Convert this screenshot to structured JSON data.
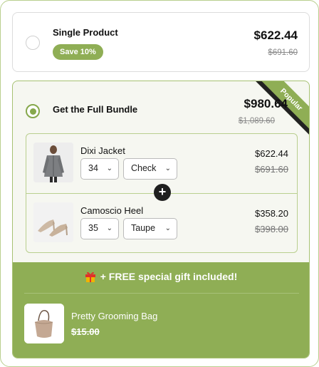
{
  "single_option": {
    "title": "Single Product",
    "badge": "Save 10%",
    "price": "$622.44",
    "old_price": "$691.60"
  },
  "bundle_option": {
    "title": "Get the Full Bundle",
    "ribbon": "Popular",
    "price": "$980.64",
    "old_price": "$1,089.60",
    "items": [
      {
        "name": "Dixi Jacket",
        "size": "34",
        "color": "Check",
        "price": "$622.44",
        "old_price": "$691.60",
        "image_icon": "jacket-icon"
      },
      {
        "name": "Camoscio Heel",
        "size": "35",
        "color": "Taupe",
        "price": "$358.20",
        "old_price": "$398.00",
        "image_icon": "heels-icon"
      }
    ],
    "plus_icon": "plus-icon"
  },
  "gift": {
    "heading": "+ FREE special gift included!",
    "icon": "gift-icon",
    "name": "Pretty Grooming Bag",
    "old_price": "$15.00",
    "image_icon": "bag-icon"
  },
  "colors": {
    "accent_green": "#8fae55",
    "border_green": "#b9cf8e",
    "bundle_bg": "#f6f7f1"
  }
}
